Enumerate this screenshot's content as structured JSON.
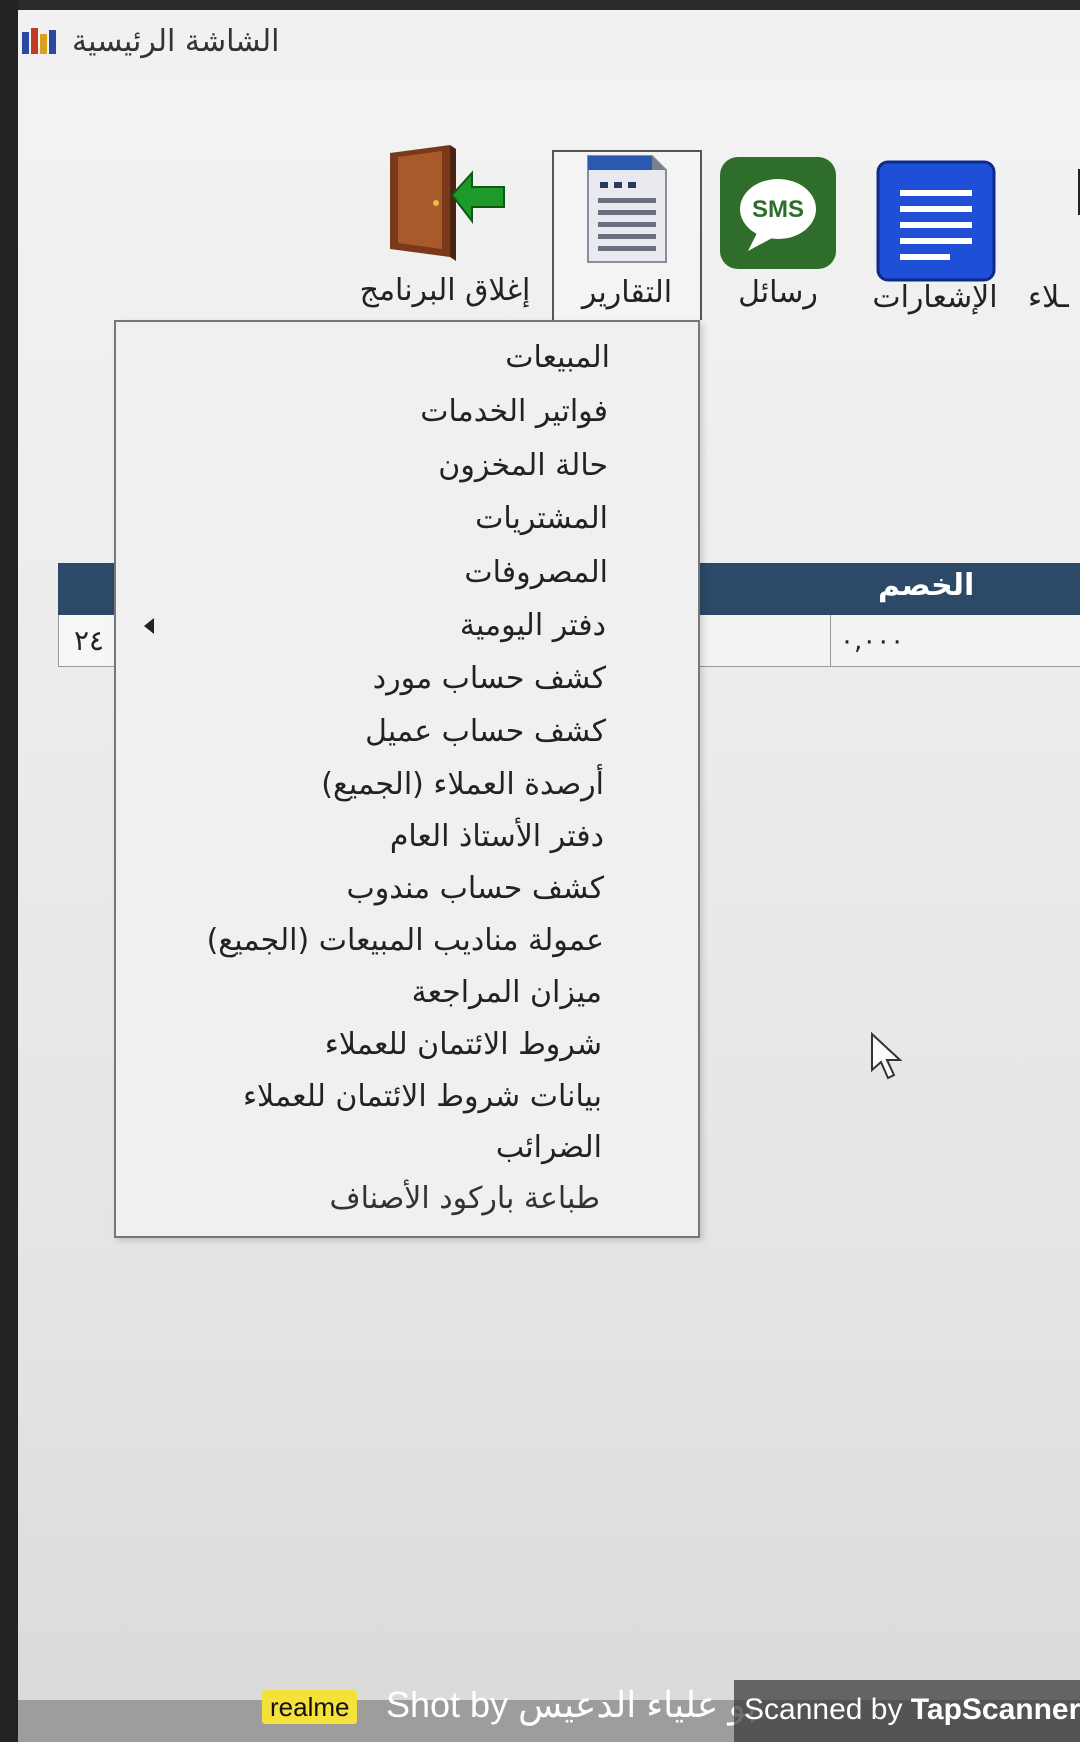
{
  "window": {
    "title": "الشاشة الرئيسية"
  },
  "toolbar": {
    "close_program": "إغلاق البرنامج",
    "reports": "التقارير",
    "messages": "رسائل",
    "notices": "الإشعارات",
    "partial_label": "ـلاء",
    "sms_badge": "SMS"
  },
  "reports_menu": {
    "items": [
      "المبيعات",
      "فواتير الخدمات",
      "حالة المخزون",
      "المشتريات",
      "المصروفات",
      "دفتر اليومية",
      "كشف حساب مورد",
      "كشف حساب عميل",
      "أرصدة العملاء (الجميع)",
      "دفتر الأستاذ العام",
      "كشف حساب مندوب",
      "عمولة مناديب المبيعات (الجميع)",
      "ميزان المراجعة",
      "شروط الائتمان للعملاء",
      "بيانات شروط الائتمان للعملاء",
      "الضرائب",
      "طباعة باركود الأصناف"
    ]
  },
  "table": {
    "col_discount": "الخصم",
    "cell_left": "٢٤",
    "cell_discount": "٠,٠٠٠"
  },
  "watermark": {
    "brand": "realme",
    "shot_by": "Shot by بو علياء الدعيس",
    "scanned_by": "Scanned by",
    "scanner_name": "TapScanner"
  },
  "colors": {
    "table_header": "#2c4a68",
    "sms_green": "#2f6e2a",
    "notices_blue": "#1f4fd6",
    "door_arrow_green": "#1e9a2a"
  },
  "icons": {
    "close_program": "exit-door-icon",
    "reports": "document-icon",
    "messages": "sms-bubble-icon",
    "notices": "notice-list-icon"
  }
}
